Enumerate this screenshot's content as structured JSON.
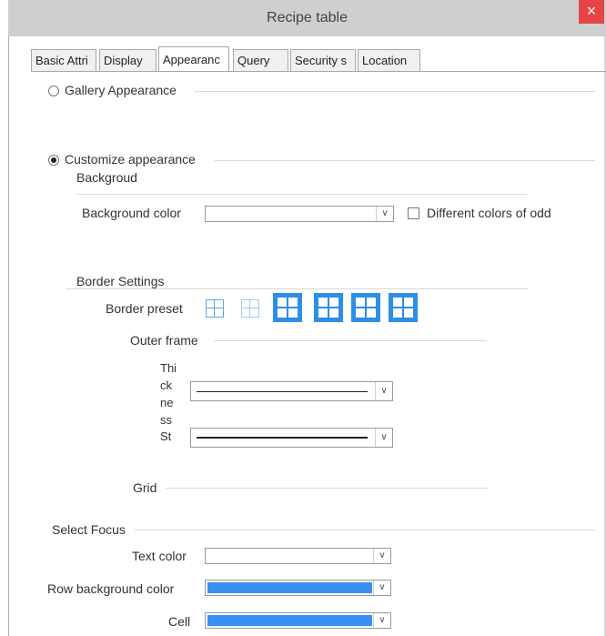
{
  "window": {
    "title": "Recipe table",
    "close_glyph": "×"
  },
  "tabs": [
    "Basic Attri",
    "Display",
    "Appearanc",
    "Query",
    "Security s",
    "Location"
  ],
  "appearance": {
    "gallery_label": "Gallery Appearance",
    "customize_label": "Customize appearance",
    "background_section": "Backgroud",
    "background_color_label": "Background color",
    "different_colors_label": "Different colors of odd",
    "border_settings_label": "Border Settings",
    "border_preset_label": "Border preset",
    "outer_frame_label": "Outer frame",
    "thickness_lines": [
      "Thi",
      "ck",
      "ne",
      "ss"
    ],
    "style_label": "St",
    "grid_label": "Grid",
    "select_focus_label": "Select Focus",
    "text_color_label": "Text color",
    "row_bg_label": "Row background color",
    "cell_label": "Cell",
    "dropdown_glyph": "∨"
  },
  "colors": {
    "accent": "#2d8ee8",
    "selection_fill": "#3a8ff0",
    "close": "#e64545"
  }
}
